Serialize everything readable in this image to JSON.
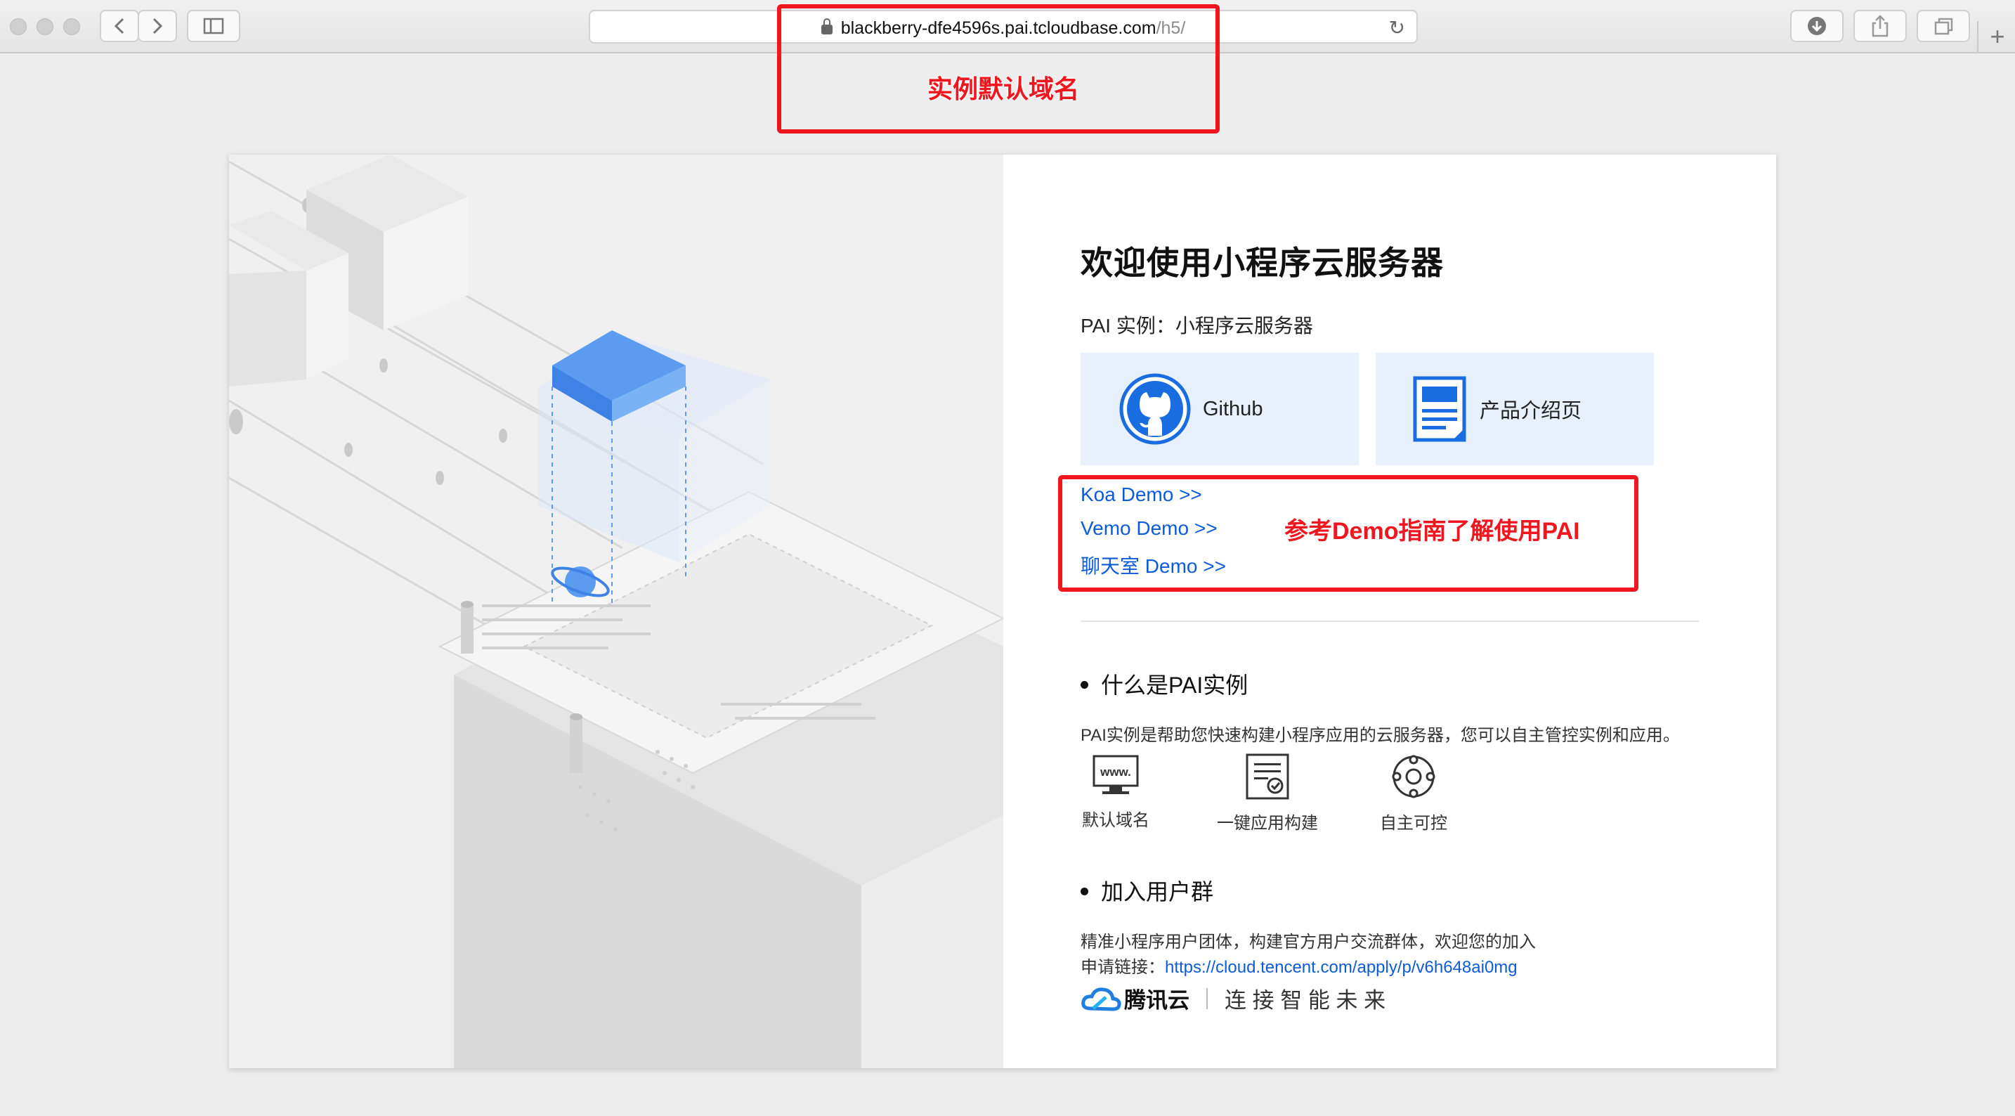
{
  "browser": {
    "url_host": "blackberry-dfe4596s.pai.tcloudbase.com",
    "url_path": "/h5/"
  },
  "annotations": {
    "domain_note": "实例默认域名",
    "demo_note": "参考Demo指南了解使用PAI"
  },
  "page": {
    "title": "欢迎使用小程序云服务器",
    "subtitle": "PAI 实例：小程序云服务器",
    "tiles": [
      {
        "label": "Github",
        "icon": "github-icon"
      },
      {
        "label": "产品介绍页",
        "icon": "document-icon"
      }
    ],
    "demos": [
      {
        "label": "Koa Demo >>"
      },
      {
        "label": "Vemo Demo >>"
      },
      {
        "label": "聊天室 Demo >>"
      }
    ],
    "section1": {
      "heading": "什么是PAI实例",
      "description": "PAI实例是帮助您快速构建小程序应用的云服务器，您可以自主管控实例和应用。",
      "features": [
        {
          "label": "默认域名",
          "icon": "www-monitor-icon"
        },
        {
          "label": "一键应用构建",
          "icon": "build-document-icon"
        },
        {
          "label": "自主可控",
          "icon": "control-ring-icon"
        }
      ]
    },
    "section2": {
      "heading": "加入用户群",
      "line1": "精准小程序用户团体，构建官方用户交流群体，欢迎您的加入",
      "apply_prefix": "申请链接：",
      "apply_link": "https://cloud.tencent.com/apply/p/v6h648ai0mg"
    },
    "brand": {
      "name": "腾讯云",
      "slogan": "连 接 智 能 未 来"
    }
  },
  "colors": {
    "accent": "#0d5bd8",
    "annotation": "#f01620",
    "tile_bg": "#e8f0fb"
  }
}
